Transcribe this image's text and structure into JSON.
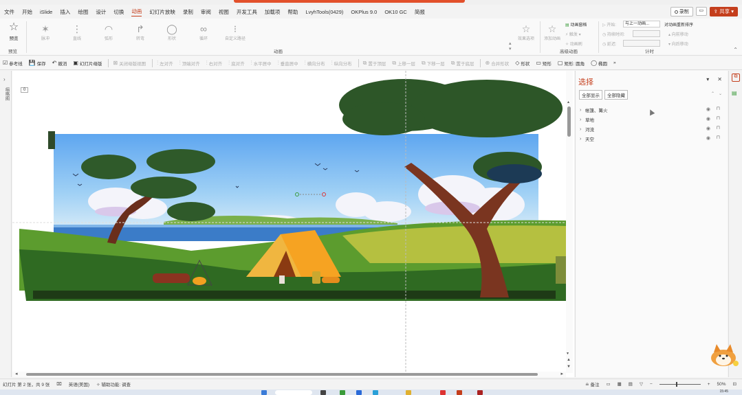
{
  "menubar": {
    "items": [
      "文件",
      "开始",
      "iSlide",
      "插入",
      "绘图",
      "设计",
      "切换",
      "动画",
      "幻灯片放映",
      "录制",
      "审阅",
      "视图",
      "开发工具",
      "加载项",
      "帮助",
      "LvyhTools(0429)",
      "OKPlus 9.0",
      "OK10 GC",
      "简报"
    ],
    "active_index": 7,
    "record_label": "录制",
    "share_label": "共享"
  },
  "ribbon": {
    "preview_label": "预览",
    "preview_group": "预览",
    "animations": [
      "脉冲",
      "直线",
      "弧形",
      "转弯",
      "形状",
      "循环",
      "自定义路径"
    ],
    "animation_group": "动画",
    "effect_options": "效果选项",
    "add_animation": "添加动画",
    "anim_pane": "动画窗格",
    "trigger": "触发",
    "anim_painter": "动画刷",
    "advanced_group": "高级动画",
    "start_label": "开始:",
    "start_value": "与上一动画...",
    "duration_label": "持续时间:",
    "delay_label": "延迟:",
    "reorder_label": "对动画重新排序",
    "move_earlier": "向前移动",
    "move_later": "向后移动",
    "timing_group": "计时"
  },
  "toolbar2": {
    "items": [
      {
        "label": "参考线",
        "disabled": false,
        "icon": "checkbox"
      },
      {
        "label": "保存",
        "disabled": false,
        "icon": "save"
      },
      {
        "label": "撤消",
        "disabled": false,
        "icon": "undo"
      },
      {
        "label": "幻灯片母版",
        "disabled": false,
        "icon": "master"
      },
      {
        "label": "关闭母版视图",
        "disabled": true,
        "icon": "close"
      },
      {
        "label": "左对齐",
        "disabled": true,
        "icon": "align"
      },
      {
        "label": "顶端对齐",
        "disabled": true,
        "icon": "align"
      },
      {
        "label": "右对齐",
        "disabled": true,
        "icon": "align"
      },
      {
        "label": "底对齐",
        "disabled": true,
        "icon": "align"
      },
      {
        "label": "水平居中",
        "disabled": true,
        "icon": "align"
      },
      {
        "label": "垂直居中",
        "disabled": true,
        "icon": "align"
      },
      {
        "label": "横向分布",
        "disabled": true,
        "icon": "align"
      },
      {
        "label": "纵向分布",
        "disabled": true,
        "icon": "align"
      },
      {
        "label": "置于顶层",
        "disabled": true,
        "icon": "layer"
      },
      {
        "label": "上移一层",
        "disabled": true,
        "icon": "layer"
      },
      {
        "label": "下移一层",
        "disabled": true,
        "icon": "layer"
      },
      {
        "label": "置于底层",
        "disabled": true,
        "icon": "layer"
      },
      {
        "label": "合并形状",
        "disabled": true,
        "icon": "merge"
      },
      {
        "label": "形状",
        "disabled": false,
        "icon": "shape"
      },
      {
        "label": "矩形",
        "disabled": false,
        "icon": "rect"
      },
      {
        "label": "矩形: 圆角",
        "disabled": false,
        "icon": "rounded"
      },
      {
        "label": "椭圆",
        "disabled": false,
        "icon": "ellipse"
      }
    ]
  },
  "left_pane": {
    "label": "缩略图"
  },
  "canvas": {
    "slide_tag": "0"
  },
  "selection_pane": {
    "title": "选择",
    "show_all": "全部显示",
    "hide_all": "全部隐藏",
    "items": [
      "帐篷、篝火",
      "草地",
      "河流",
      "天空"
    ]
  },
  "statusbar": {
    "slide_info": "幻灯片 第 2 张，共 9 张",
    "language": "英语(美国)",
    "accessibility": "辅助功能: 调查",
    "notes": "备注",
    "zoom": "50%"
  },
  "taskbar": {
    "time": "15:45"
  },
  "colors": {
    "accent": "#c43e1c",
    "sky": "#6aaef0",
    "grass": "#3f7a2a",
    "tent": "#f0a020"
  }
}
